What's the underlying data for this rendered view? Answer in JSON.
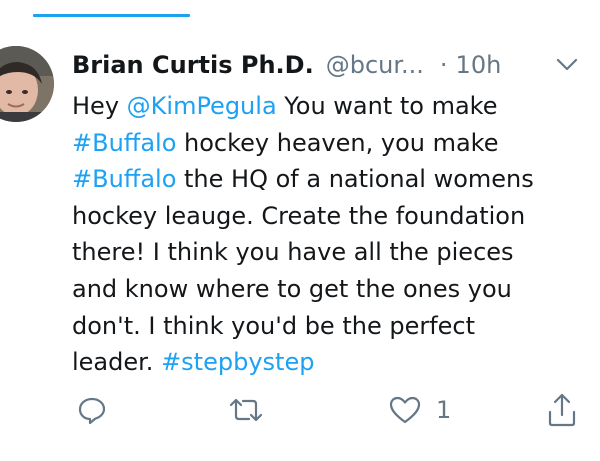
{
  "tweet": {
    "author": {
      "display_name": "Brian Curtis Ph.D.",
      "handle": "@bcur...",
      "separator": "·",
      "time": "10h"
    },
    "text_lines": [
      [
        {
          "t": "Hey ",
          "link": false
        },
        {
          "t": "@KimPegula",
          "link": true
        },
        {
          "t": " You want to make",
          "link": false
        }
      ],
      [
        {
          "t": "#Buffalo",
          "link": true
        },
        {
          "t": " hockey heaven, you make",
          "link": false
        }
      ],
      [
        {
          "t": "#Buffalo",
          "link": true
        },
        {
          "t": " the HQ of a national womens",
          "link": false
        }
      ],
      [
        {
          "t": "hockey leauge. Create the foundation",
          "link": false
        }
      ],
      [
        {
          "t": "there! I think you have all the pieces",
          "link": false
        }
      ],
      [
        {
          "t": "and know where to get the ones you",
          "link": false
        }
      ],
      [
        {
          "t": "don't. I think you'd be the perfect",
          "link": false
        }
      ],
      [
        {
          "t": "leader. ",
          "link": false
        },
        {
          "t": "#stepbystep",
          "link": true
        }
      ]
    ],
    "actions": {
      "reply_icon": "reply-icon",
      "retweet_icon": "retweet-icon",
      "like_icon": "like-icon",
      "like_count": "1",
      "share_icon": "share-icon"
    }
  },
  "colors": {
    "accent": "#1da1f2",
    "text": "#14171a",
    "muted": "#657786"
  }
}
